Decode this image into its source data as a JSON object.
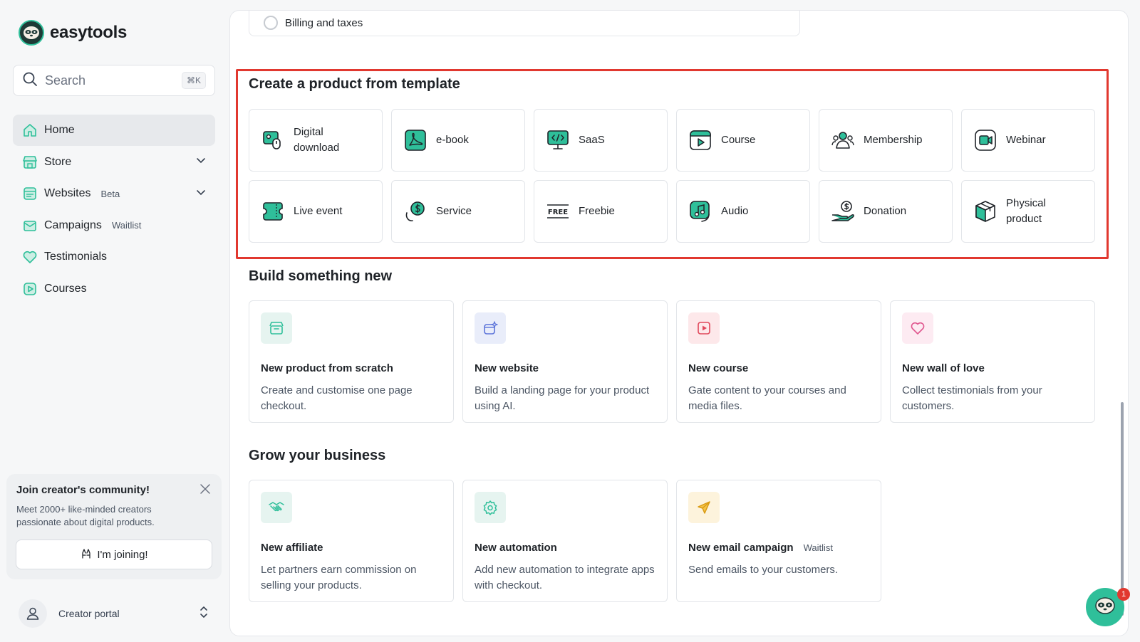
{
  "app": {
    "name": "easytools"
  },
  "search": {
    "placeholder": "Search",
    "shortcut": "⌘K"
  },
  "sidebar": {
    "items": [
      {
        "label": "Home",
        "badge": "",
        "active": true,
        "icon": "home-icon"
      },
      {
        "label": "Store",
        "badge": "",
        "chevron": true,
        "icon": "store-icon"
      },
      {
        "label": "Websites",
        "badge": "Beta",
        "chevron": true,
        "icon": "websites-icon"
      },
      {
        "label": "Campaigns",
        "badge": "Waitlist",
        "icon": "campaigns-icon"
      },
      {
        "label": "Testimonials",
        "badge": "",
        "icon": "heart-icon"
      },
      {
        "label": "Courses",
        "badge": "",
        "icon": "play-icon"
      }
    ]
  },
  "community": {
    "title": "Join creator's community!",
    "text": "Meet 2000+ like-minded creators passionate about digital products.",
    "button": "I'm joining!"
  },
  "footer": {
    "creator_label": "Creator portal"
  },
  "billing": {
    "label": "Billing and taxes"
  },
  "templates": {
    "title": "Create a product from template",
    "items": [
      {
        "label": "Digital download",
        "icon": "digital-download-icon"
      },
      {
        "label": "e-book",
        "icon": "ebook-icon"
      },
      {
        "label": "SaaS",
        "icon": "saas-icon"
      },
      {
        "label": "Course",
        "icon": "course-icon"
      },
      {
        "label": "Membership",
        "icon": "membership-icon"
      },
      {
        "label": "Webinar",
        "icon": "webinar-icon"
      },
      {
        "label": "Live event",
        "icon": "live-event-icon"
      },
      {
        "label": "Service",
        "icon": "service-icon"
      },
      {
        "label": "Freebie",
        "icon": "freebie-icon"
      },
      {
        "label": "Audio",
        "icon": "audio-icon"
      },
      {
        "label": "Donation",
        "icon": "donation-icon"
      },
      {
        "label": "Physical product",
        "icon": "physical-product-icon"
      }
    ]
  },
  "build": {
    "title": "Build something new",
    "items": [
      {
        "title": "New product from scratch",
        "badge": "",
        "desc": "Create and customise one page checkout.",
        "icon": "product-icon",
        "color": "#e6f4f0"
      },
      {
        "title": "New website",
        "badge": "",
        "desc": "Build a landing page for your product using AI.",
        "icon": "website-sparkle-icon",
        "color": "#e9edfa"
      },
      {
        "title": "New course",
        "badge": "",
        "desc": "Gate content to your courses and media files.",
        "icon": "course-play-icon",
        "color": "#fde8ea"
      },
      {
        "title": "New wall of love",
        "badge": "",
        "desc": "Collect testimonials from your customers.",
        "icon": "heart-icon",
        "color": "#fdebf2"
      }
    ]
  },
  "grow": {
    "title": "Grow your business",
    "items": [
      {
        "title": "New affiliate",
        "badge": "",
        "desc": "Let partners earn commission on selling your products.",
        "icon": "handshake-icon",
        "color": "#e6f4f0"
      },
      {
        "title": "New automation",
        "badge": "",
        "desc": "Add new automation to integrate apps with checkout.",
        "icon": "gear-icon",
        "color": "#e6f4f0"
      },
      {
        "title": "New email campaign",
        "badge": "Waitlist",
        "desc": "Send emails to your customers.",
        "icon": "send-icon",
        "color": "#fdf3dc"
      }
    ]
  },
  "chat": {
    "count": "1"
  },
  "colors": {
    "accent": "#2fbf9a",
    "highlight": "#e1382f"
  }
}
